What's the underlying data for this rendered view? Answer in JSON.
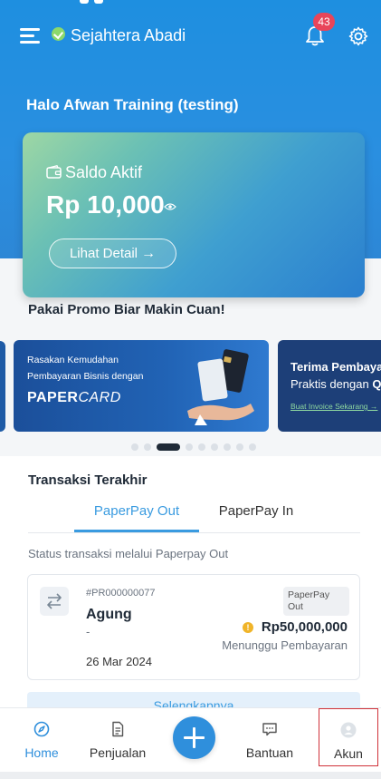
{
  "header": {
    "company_name": "Sejahtera Abadi",
    "notification_count": "43",
    "greeting": "Halo Afwan Training (testing)"
  },
  "balance": {
    "label": "Saldo Aktif",
    "amount": "Rp 10,000",
    "detail_button": "Lihat Detail"
  },
  "promo": {
    "title": "Pakai Promo Biar Makin Cuan!",
    "banner1": {
      "line1": "Rasakan Kemudahan",
      "line2": "Pembayaran Bisnis dengan",
      "brand_bold": "PAPER",
      "brand_italic": "CARD"
    },
    "banner2": {
      "title": "Terima Pembayar",
      "subtitle_prefix": "Praktis dengan ",
      "subtitle_bold": "Q",
      "link": "Buat Invoice Sekarang"
    },
    "carousel_active_index": 2,
    "carousel_count": 10
  },
  "transactions": {
    "title": "Transaksi Terakhir",
    "tabs": [
      {
        "label": "PaperPay Out",
        "active": true
      },
      {
        "label": "PaperPay In",
        "active": false
      }
    ],
    "status_note": "Status transaksi melalui Paperpay Out",
    "items": [
      {
        "id": "#PR000000077",
        "name": "Agung",
        "dash": "-",
        "type": "PaperPay Out",
        "amount": "Rp50,000,000",
        "status": "Menunggu Pembayaran",
        "date": "26 Mar 2024"
      }
    ],
    "see_all": "Selengkapnya"
  },
  "bottom_nav": {
    "items": [
      {
        "label": "Home",
        "icon": "compass-icon"
      },
      {
        "label": "Penjualan",
        "icon": "document-icon"
      },
      {
        "label": "Bantuan",
        "icon": "chat-icon"
      },
      {
        "label": "Akun",
        "icon": "account-icon"
      }
    ],
    "fab_icon": "plus-icon"
  },
  "colors": {
    "primary": "#2f8fdc",
    "badge": "#e8455a",
    "warning": "#f0b429"
  }
}
